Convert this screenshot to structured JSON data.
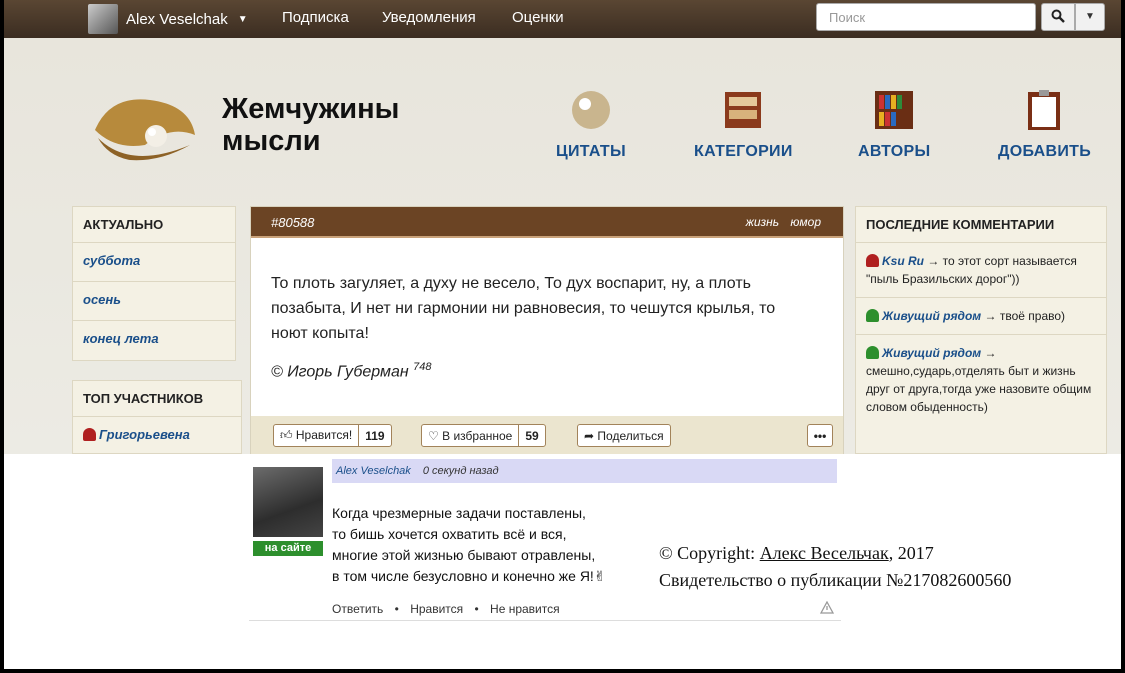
{
  "topbar": {
    "user_name": "Alex Veselchak",
    "links": [
      "Подписка",
      "Уведомления",
      "Оценки"
    ],
    "search_placeholder": "Поиск"
  },
  "site": {
    "logo_line1": "Жемчужины",
    "logo_line2": "мысли",
    "nav": [
      "ЦИТАТЫ",
      "КАТЕГОРИИ",
      "АВТОРЫ",
      "ДОБАВИТЬ"
    ]
  },
  "sidebar_left": {
    "actual_title": "АКТУАЛЬНО",
    "actual_items": [
      "суббота",
      "осень",
      "конец лета"
    ],
    "top_title": "ТОП УЧАСТНИКОВ",
    "top_items": [
      "Григорьевена"
    ]
  },
  "quote": {
    "id": "#80588",
    "tags": [
      "жизнь",
      "юмор"
    ],
    "text": "То плоть загуляет, а духу не весело, То дух воспарит, ну, а плоть позабыта, И нет ни гармонии ни равновесия, то чешутся крылья, то ноют копыта!",
    "author": "© Игорь Губерман",
    "author_count": "748",
    "like_label": "Нравится!",
    "like_count": "119",
    "fav_label": "В избранное",
    "fav_count": "59",
    "share_label": "Поделиться",
    "more_label": "•••"
  },
  "last_comments": {
    "title": "ПОСЛЕДНИЕ КОММЕНТАРИИ",
    "items": [
      {
        "user": "Ksu Ru",
        "text": "→ то этот сорт называется \"пыль Бразильских дорог\"))"
      },
      {
        "user": "Живущий рядом",
        "text": "→ твоё право)"
      },
      {
        "user": "Живущий рядом",
        "text": "→ смешно,сударь,отделять быт и жизнь друг от друга,тогда уже назовите общим словом обыденность)"
      }
    ]
  },
  "comment": {
    "user": "Alex Veselchak",
    "time": "0 секунд назад",
    "online": "на сайте",
    "lines": [
      "Когда чрезмерные задачи поставлены,",
      "то бишь хочется охватить всё и вся,",
      "многие этой жизнью бывают отравлены,",
      "в том числе безусловно и конечно же Я!✌"
    ],
    "reply": "Ответить",
    "like": "Нравится",
    "dislike": "Не нравится",
    "separator": "•"
  },
  "copyright": {
    "prefix": "© Copyright: ",
    "author": "Алекс Весельчак",
    "year": ", 2017",
    "certificate": "Свидетельство о публикации №217082600560"
  }
}
